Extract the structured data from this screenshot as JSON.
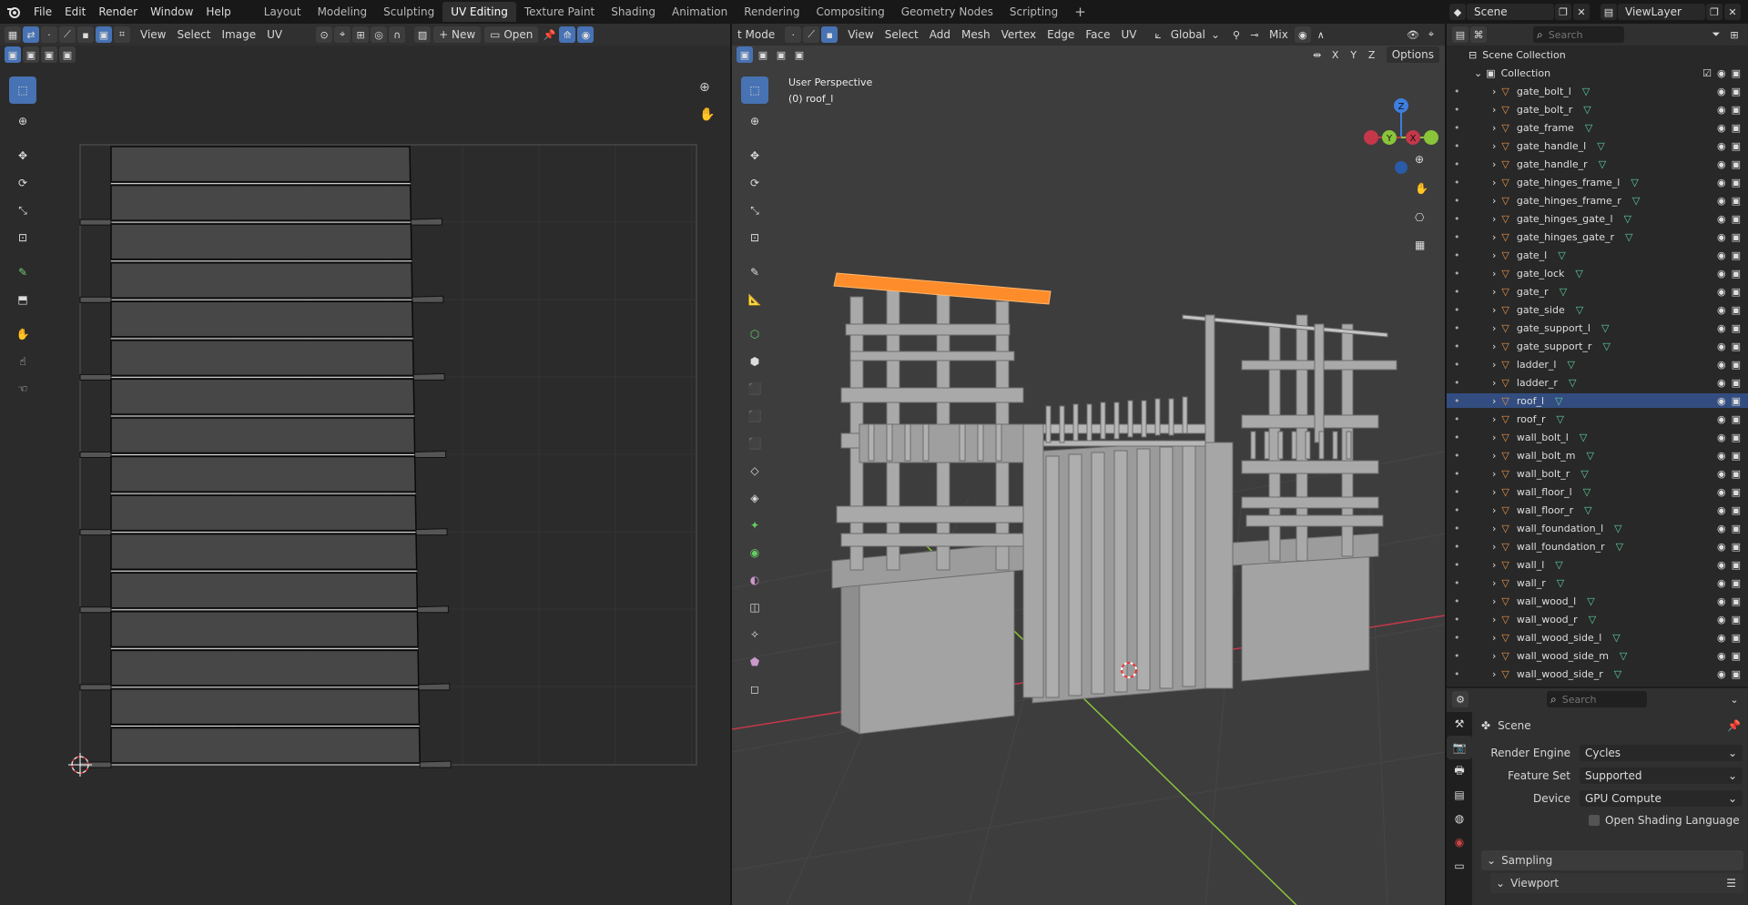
{
  "topbar": {
    "menus": [
      "File",
      "Edit",
      "Render",
      "Window",
      "Help"
    ],
    "workspaces": [
      "Layout",
      "Modeling",
      "Sculpting",
      "UV Editing",
      "Texture Paint",
      "Shading",
      "Animation",
      "Rendering",
      "Compositing",
      "Geometry Nodes",
      "Scripting"
    ],
    "active_workspace": "UV Editing",
    "add_tab": "+",
    "scene": "Scene",
    "view_layer": "ViewLayer"
  },
  "uv_editor": {
    "menus": [
      "View",
      "Select",
      "Image",
      "UV"
    ],
    "new_label": "New",
    "open_label": "Open"
  },
  "viewport": {
    "mode_label": "t Mode",
    "menus": [
      "View",
      "Select",
      "Add",
      "Mesh",
      "Vertex",
      "Edge",
      "Face",
      "UV"
    ],
    "orientation": "Global",
    "snap_mode": "Mix",
    "axis_x": "X",
    "axis_y": "Y",
    "axis_z": "Z",
    "options_label": "Options",
    "overlay_title": "User Perspective",
    "overlay_object": "(0) roof_l",
    "gizmo_labels": {
      "z": "Z",
      "y": "Y",
      "x": "X"
    }
  },
  "outliner": {
    "search_placeholder": "Search",
    "scene_collection": "Scene Collection",
    "collection": "Collection",
    "selected": "roof_l",
    "objects": [
      "gate_bolt_l",
      "gate_bolt_r",
      "gate_frame",
      "gate_handle_l",
      "gate_handle_r",
      "gate_hinges_frame_l",
      "gate_hinges_frame_r",
      "gate_hinges_gate_l",
      "gate_hinges_gate_r",
      "gate_l",
      "gate_lock",
      "gate_r",
      "gate_side",
      "gate_support_l",
      "gate_support_r",
      "ladder_l",
      "ladder_r",
      "roof_l",
      "roof_r",
      "wall_bolt_l",
      "wall_bolt_m",
      "wall_bolt_r",
      "wall_floor_l",
      "wall_floor_r",
      "wall_foundation_l",
      "wall_foundation_r",
      "wall_l",
      "wall_r",
      "wall_wood_l",
      "wall_wood_r",
      "wall_wood_side_l",
      "wall_wood_side_m",
      "wall_wood_side_r"
    ]
  },
  "properties": {
    "search_placeholder": "Search",
    "context": "Scene",
    "render_engine_label": "Render Engine",
    "render_engine": "Cycles",
    "feature_set_label": "Feature Set",
    "feature_set": "Supported",
    "device_label": "Device",
    "device": "GPU Compute",
    "open_shading_label": "Open Shading Language",
    "sampling_label": "Sampling",
    "viewport_label": "Viewport"
  },
  "colors": {
    "accent": "#4772b3",
    "selected_orange": "#ff8c2a",
    "x_axis": "#c4384a",
    "y_axis": "#8ac43a",
    "z_axis": "#3d7ee0",
    "mesh_icon": "#5fd0a0",
    "object_icon": "#e8954a"
  },
  "icons": [
    "blender-logo",
    "select-box-icon",
    "cursor-icon",
    "move-icon",
    "rotate-icon",
    "scale-icon",
    "transform-icon",
    "annotate-icon",
    "measure-icon",
    "eye-icon",
    "camera-icon",
    "checkbox-icon",
    "search-icon",
    "filter-icon",
    "zoom-icon",
    "hand-icon",
    "pin-icon"
  ]
}
